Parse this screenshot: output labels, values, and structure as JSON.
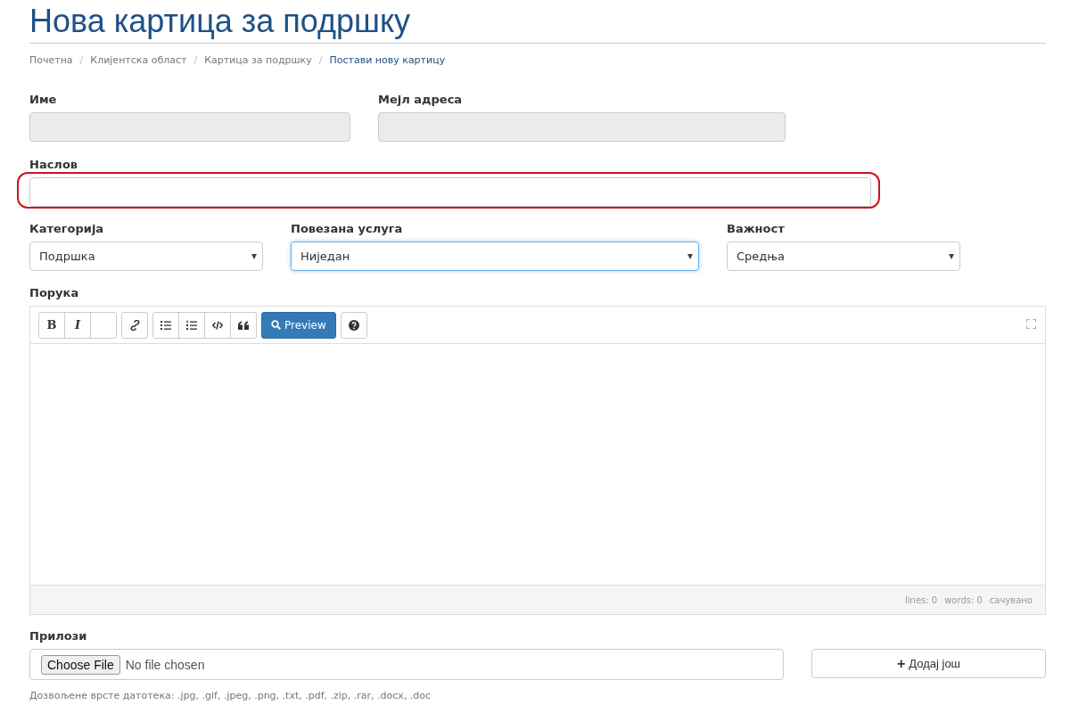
{
  "page_title": "Нова картица за подршку",
  "breadcrumb": [
    {
      "label": "Почетна",
      "selected": false
    },
    {
      "label": "Клијентска област",
      "selected": false
    },
    {
      "label": "Картица за подршку",
      "selected": false
    },
    {
      "label": "Постави нову картицу",
      "selected": true
    }
  ],
  "breadcrumb_separator": "/",
  "contact_fields": [
    {
      "label": "Име",
      "disabled": true
    },
    {
      "label": "Мејл адреса",
      "disabled": true
    }
  ],
  "subject": {
    "label": "Наслов",
    "highlighted": true
  },
  "selects": [
    {
      "label": "Категорија",
      "value": "Подршка",
      "focused": false
    },
    {
      "label": "Повезана услуга",
      "value": "Ниједан",
      "focused": true
    },
    {
      "label": "Важност",
      "value": "Средња",
      "focused": false
    }
  ],
  "message": {
    "label": "Порука",
    "toolbar": [
      [
        {
          "kind": "bold",
          "label": "B"
        },
        {
          "kind": "italic",
          "label": "I"
        },
        {
          "kind": "blank"
        }
      ],
      [
        {
          "kind": "link"
        }
      ],
      [
        {
          "kind": "bullets"
        },
        {
          "kind": "numbers"
        },
        {
          "kind": "code"
        },
        {
          "kind": "quote"
        }
      ],
      [
        {
          "kind": "preview",
          "label": "Preview"
        }
      ],
      [
        {
          "kind": "help"
        }
      ]
    ],
    "status": [
      "lines: 0",
      "words: 0",
      "сачувано"
    ]
  },
  "attachments": {
    "label": "Прилози",
    "choose_button": "Choose File",
    "file_status": "No file chosen",
    "add_button": "Додај још",
    "add_icon": "+",
    "hint": "Дозвољене врсте датотека: .jpg, .gif, .jpeg, .png, .txt, .pdf, .zip, .rar, .docx, .doc"
  }
}
